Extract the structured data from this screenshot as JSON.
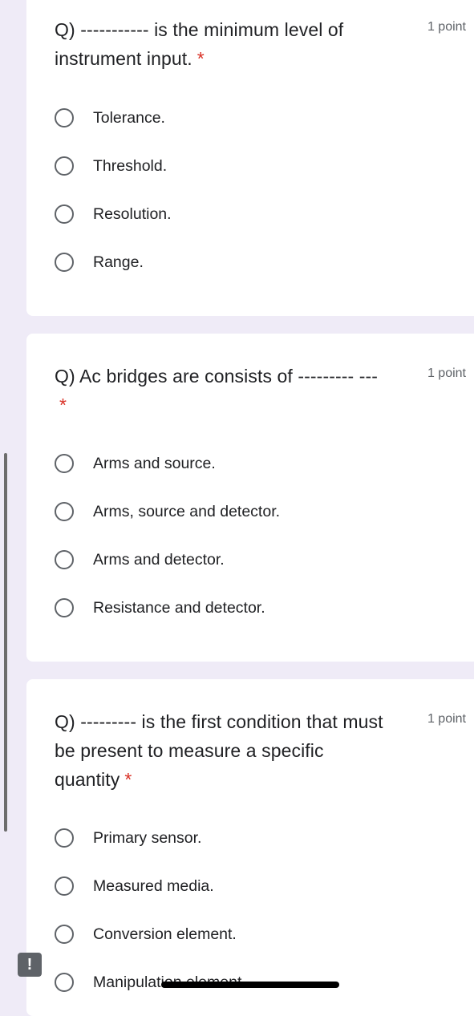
{
  "questions": [
    {
      "title": "Q) ----------- is the minimum level of instrument input.",
      "points": "1 point",
      "required_mark": "*",
      "options": [
        "Tolerance.",
        "Threshold.",
        "Resolution.",
        "Range."
      ]
    },
    {
      "title": "Q) Ac bridges are consists of --------- ---",
      "points": "1 point",
      "required_mark": "*",
      "options": [
        "Arms and source.",
        "Arms, source and detector.",
        "Arms and detector.",
        "Resistance and detector."
      ]
    },
    {
      "title": "Q) --------- is the first condition that must be present to measure a specific quantity",
      "points": "1 point",
      "required_mark": "*",
      "options": [
        "Primary sensor.",
        "Measured media.",
        "Conversion element.",
        "Manipulation element."
      ]
    }
  ],
  "feedback_badge": {
    "icon": "exclamation-icon",
    "glyph": "!"
  },
  "colors": {
    "page_background": "#efebf7",
    "card_background": "#ffffff",
    "required_asterisk": "#d93025",
    "secondary_text": "#5f6368"
  }
}
